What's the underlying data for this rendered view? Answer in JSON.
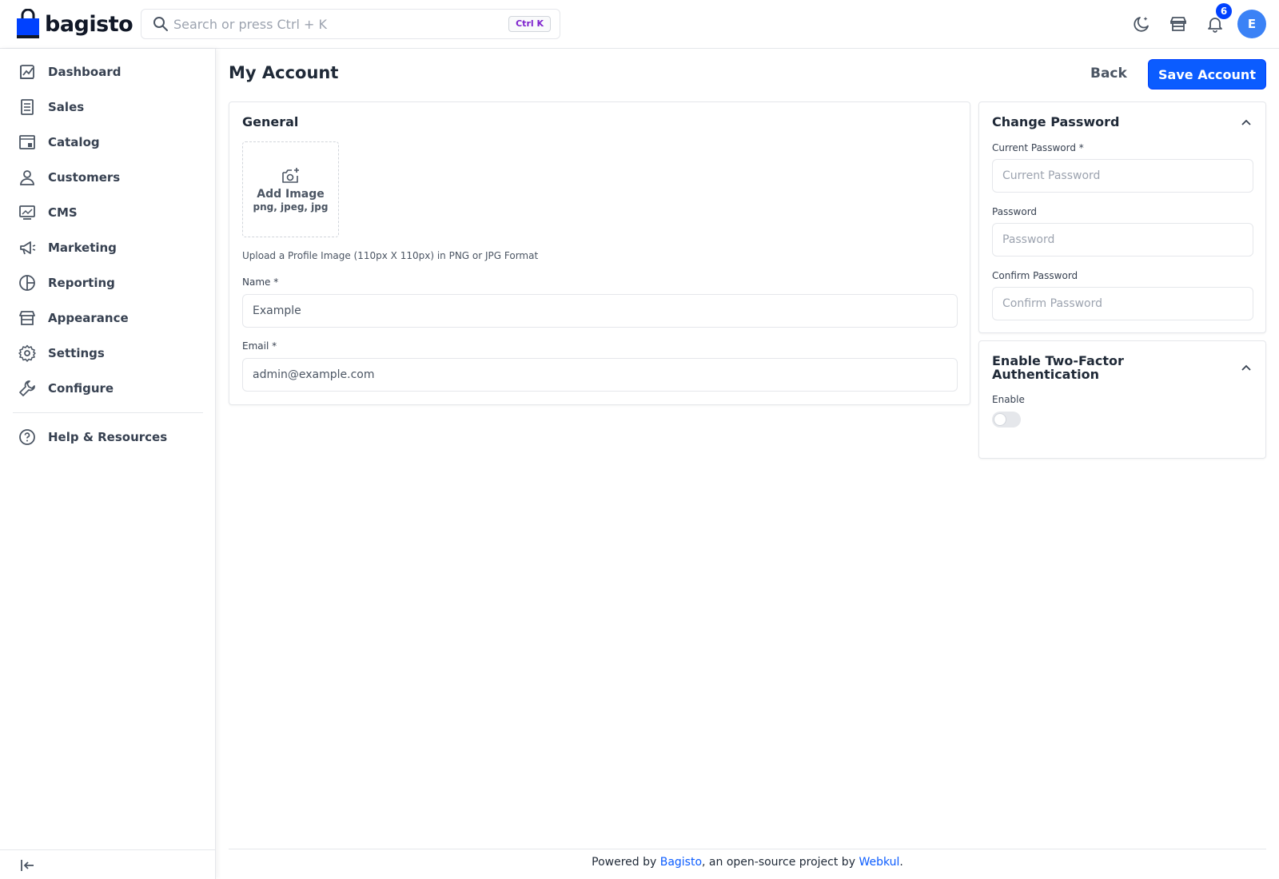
{
  "header": {
    "logo_text": "bagisto",
    "search_placeholder": "Search or press Ctrl + K",
    "search_shortcut": "Ctrl K",
    "notification_count": "6",
    "avatar_initial": "E"
  },
  "sidebar": {
    "items": [
      {
        "label": "Dashboard",
        "icon": "dashboard-icon"
      },
      {
        "label": "Sales",
        "icon": "sales-icon"
      },
      {
        "label": "Catalog",
        "icon": "catalog-icon"
      },
      {
        "label": "Customers",
        "icon": "customers-icon"
      },
      {
        "label": "CMS",
        "icon": "cms-icon"
      },
      {
        "label": "Marketing",
        "icon": "marketing-icon"
      },
      {
        "label": "Reporting",
        "icon": "reporting-icon"
      },
      {
        "label": "Appearance",
        "icon": "appearance-icon"
      },
      {
        "label": "Settings",
        "icon": "settings-icon"
      },
      {
        "label": "Configure",
        "icon": "configure-icon"
      }
    ],
    "help_label": "Help & Resources"
  },
  "page": {
    "title": "My Account",
    "back_label": "Back",
    "save_label": "Save Account"
  },
  "general": {
    "title": "General",
    "add_image_label": "Add Image",
    "image_formats": "png, jpeg, jpg",
    "upload_hint": "Upload a Profile Image (110px X 110px) in PNG or JPG Format",
    "name_label": "Name *",
    "name_value": "Example",
    "email_label": "Email *",
    "email_value": "admin@example.com"
  },
  "change_password": {
    "title": "Change Password",
    "current_label": "Current Password *",
    "current_placeholder": "Current Password",
    "password_label": "Password",
    "password_placeholder": "Password",
    "confirm_label": "Confirm Password",
    "confirm_placeholder": "Confirm Password"
  },
  "two_factor": {
    "title_line1": "Enable Two-Factor",
    "title_line2": "Authentication",
    "enable_label": "Enable",
    "enabled": false
  },
  "footer": {
    "prefix": "Powered by ",
    "link1": "Bagisto",
    "middle": ", an open-source project by ",
    "link2": "Webkul",
    "suffix": "."
  },
  "colors": {
    "primary": "#0b5cff",
    "brand_blue": "#0041ff",
    "avatar": "#3b82f6",
    "shortcut_text": "#7e22ce"
  }
}
